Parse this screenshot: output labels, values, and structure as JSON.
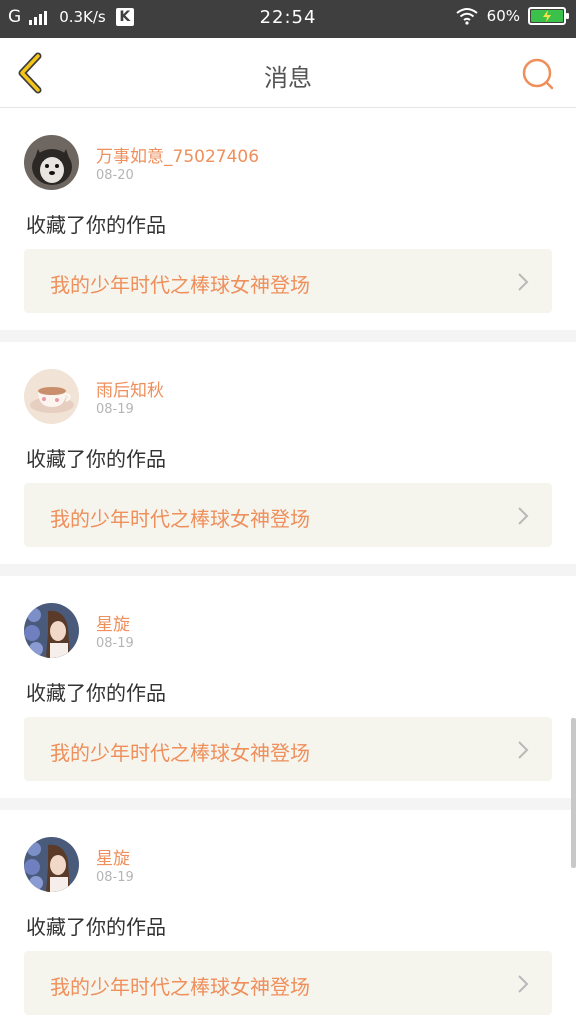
{
  "status_bar": {
    "network": "G",
    "speed": "0.3K/s",
    "k_badge": "K",
    "time": "22:54",
    "battery": "60%"
  },
  "header": {
    "title": "消息",
    "back_icon": "chevron-left-icon",
    "search_icon": "search-icon"
  },
  "colors": {
    "accent": "#ef8f5b",
    "back_arrow": "#f5c518",
    "card_bg": "#f5f5ee",
    "divider": "#f4f4f4"
  },
  "messages": [
    {
      "username": "万事如意_75027406",
      "date": "08-20",
      "action": "收藏了你的作品",
      "work_title": "我的少年时代之棒球女神登场",
      "avatar": "dog-avatar"
    },
    {
      "username": "雨后知秋",
      "date": "08-19",
      "action": "收藏了你的作品",
      "work_title": "我的少年时代之棒球女神登场",
      "avatar": "teacup-avatar"
    },
    {
      "username": "星旋",
      "date": "08-19",
      "action": "收藏了你的作品",
      "work_title": "我的少年时代之棒球女神登场",
      "avatar": "girl-flowers-avatar"
    },
    {
      "username": "星旋",
      "date": "08-19",
      "action": "收藏了你的作品",
      "work_title": "我的少年时代之棒球女神登场",
      "avatar": "girl-flowers-avatar"
    }
  ]
}
